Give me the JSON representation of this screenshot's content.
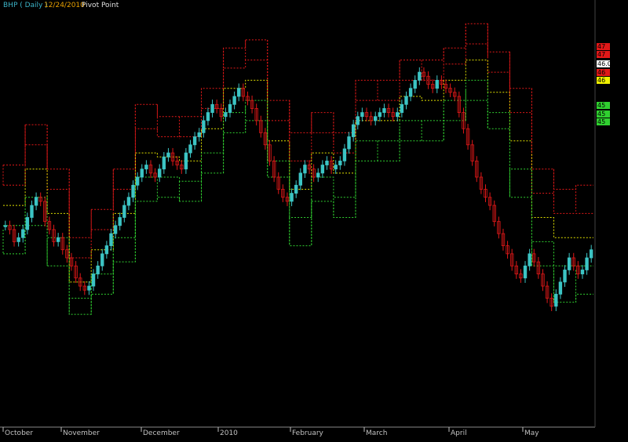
{
  "header": {
    "symbol": "BHP ( Daily )",
    "date": "12/24/2010",
    "indicator": "Pivot Point"
  },
  "colors": {
    "background": "#000000",
    "symbol": "#3cb4c8",
    "date": "#e8a000",
    "indicator": "#e0e0e0",
    "resistance": "#e01818",
    "pivot": "#e0e000",
    "support": "#30d030",
    "candle_up": "#3cc4c4",
    "candle_down": "#e01818",
    "axis": "#c0c0c0"
  },
  "right_axis_tags": [
    {
      "label": "47",
      "bg": "#e01818"
    },
    {
      "label": "47",
      "bg": "#e01818"
    },
    {
      "label": "46.04",
      "bg": "#ffffff"
    },
    {
      "label": "46",
      "bg": "#e01818"
    },
    {
      "label": "46",
      "bg": "#f0f000"
    },
    {
      "label": "45",
      "bg": "#30d030"
    },
    {
      "label": "45",
      "bg": "#30d030"
    },
    {
      "label": "45",
      "bg": "#30d030"
    }
  ],
  "chart_data": {
    "type": "candlestick",
    "x_labels": [
      "October",
      "November",
      "December",
      "2010",
      "February",
      "March",
      "April",
      "May"
    ],
    "ylim": [
      0,
      100
    ],
    "pivot_levels": [
      {
        "start": 0,
        "r2": 63,
        "r1": 58,
        "p": 53,
        "s1": 48,
        "s2": 41
      },
      {
        "start": 5,
        "r2": 73,
        "r1": 68,
        "p": 62,
        "s1": 55,
        "s2": 48
      },
      {
        "start": 10,
        "r2": 62,
        "r1": 57,
        "p": 51,
        "s1": 45,
        "s2": 38
      },
      {
        "start": 15,
        "r2": 45,
        "r1": 40,
        "p": 34,
        "s1": 30,
        "s2": 26
      },
      {
        "start": 20,
        "r2": 52,
        "r1": 47,
        "p": 42,
        "s1": 36,
        "s2": 31
      },
      {
        "start": 25,
        "r2": 62,
        "r1": 57,
        "p": 51,
        "s1": 45,
        "s2": 39
      },
      {
        "start": 30,
        "r2": 78,
        "r1": 72,
        "p": 66,
        "s1": 60,
        "s2": 54
      },
      {
        "start": 35,
        "r2": 75,
        "r1": 70,
        "p": 65,
        "s1": 60,
        "s2": 55
      },
      {
        "start": 40,
        "r2": 75,
        "r1": 70,
        "p": 64,
        "s1": 59,
        "s2": 54
      },
      {
        "start": 45,
        "r2": 82,
        "r1": 77,
        "p": 72,
        "s1": 66,
        "s2": 61
      },
      {
        "start": 50,
        "r2": 92,
        "r1": 87,
        "p": 82,
        "s1": 76,
        "s2": 71
      },
      {
        "start": 55,
        "r2": 94,
        "r1": 89,
        "p": 84,
        "s1": 79,
        "s2": 74
      },
      {
        "start": 60,
        "r2": 79,
        "r1": 74,
        "p": 69,
        "s1": 64,
        "s2": 60
      },
      {
        "start": 65,
        "r2": 71,
        "r1": 64,
        "p": 57,
        "s1": 50,
        "s2": 43
      },
      {
        "start": 70,
        "r2": 76,
        "r1": 71,
        "p": 66,
        "s1": 60,
        "s2": 54
      },
      {
        "start": 75,
        "r2": 71,
        "r1": 66,
        "p": 61,
        "s1": 55,
        "s2": 50
      },
      {
        "start": 80,
        "r2": 84,
        "r1": 79,
        "p": 74,
        "s1": 69,
        "s2": 64
      },
      {
        "start": 85,
        "r2": 84,
        "r1": 79,
        "p": 74,
        "s1": 69,
        "s2": 64
      },
      {
        "start": 90,
        "r2": 89,
        "r1": 84,
        "p": 80,
        "s1": 74,
        "s2": 69
      },
      {
        "start": 95,
        "r2": 89,
        "r1": 84,
        "p": 79,
        "s1": 74,
        "s2": 69
      },
      {
        "start": 100,
        "r2": 92,
        "r1": 88,
        "p": 84,
        "s1": 79,
        "s2": 74
      },
      {
        "start": 105,
        "r2": 98,
        "r1": 93,
        "p": 89,
        "s1": 84,
        "s2": 79
      },
      {
        "start": 110,
        "r2": 91,
        "r1": 86,
        "p": 81,
        "s1": 76,
        "s2": 72
      },
      {
        "start": 115,
        "r2": 82,
        "r1": 76,
        "p": 69,
        "s1": 62,
        "s2": 55
      },
      {
        "start": 120,
        "r2": 62,
        "r1": 56,
        "p": 50,
        "s1": 44,
        "s2": 38
      },
      {
        "start": 125,
        "r2": 57,
        "r1": 51,
        "p": 45,
        "s1": 38,
        "s2": 29
      },
      {
        "start": 130,
        "r2": 58,
        "r1": 51,
        "p": 45,
        "s1": 38,
        "s2": 31
      }
    ],
    "closes": [
      48,
      47,
      44,
      45,
      47,
      50,
      53,
      55,
      54,
      49,
      47,
      44,
      45,
      42,
      40,
      38,
      35,
      33,
      32,
      33,
      36,
      38,
      41,
      43,
      46,
      48,
      50,
      53,
      55,
      58,
      60,
      62,
      63,
      61,
      60,
      62,
      65,
      66,
      64,
      63,
      62,
      66,
      68,
      70,
      71,
      74,
      76,
      78,
      77,
      75,
      76,
      78,
      80,
      82,
      80,
      79,
      77,
      74,
      71,
      68,
      64,
      60,
      57,
      55,
      54,
      56,
      58,
      61,
      63,
      62,
      60,
      61,
      63,
      64,
      62,
      63,
      64,
      67,
      70,
      73,
      75,
      76,
      75,
      74,
      75,
      76,
      77,
      76,
      75,
      76,
      78,
      80,
      82,
      84,
      86,
      85,
      83,
      82,
      84,
      83,
      82,
      81,
      80,
      76,
      72,
      68,
      64,
      60,
      57,
      55,
      53,
      49,
      46,
      43,
      41,
      38,
      36,
      35,
      38,
      41,
      39,
      36,
      33,
      30,
      28,
      31,
      34,
      37,
      40,
      38,
      36,
      37,
      40,
      42
    ]
  }
}
